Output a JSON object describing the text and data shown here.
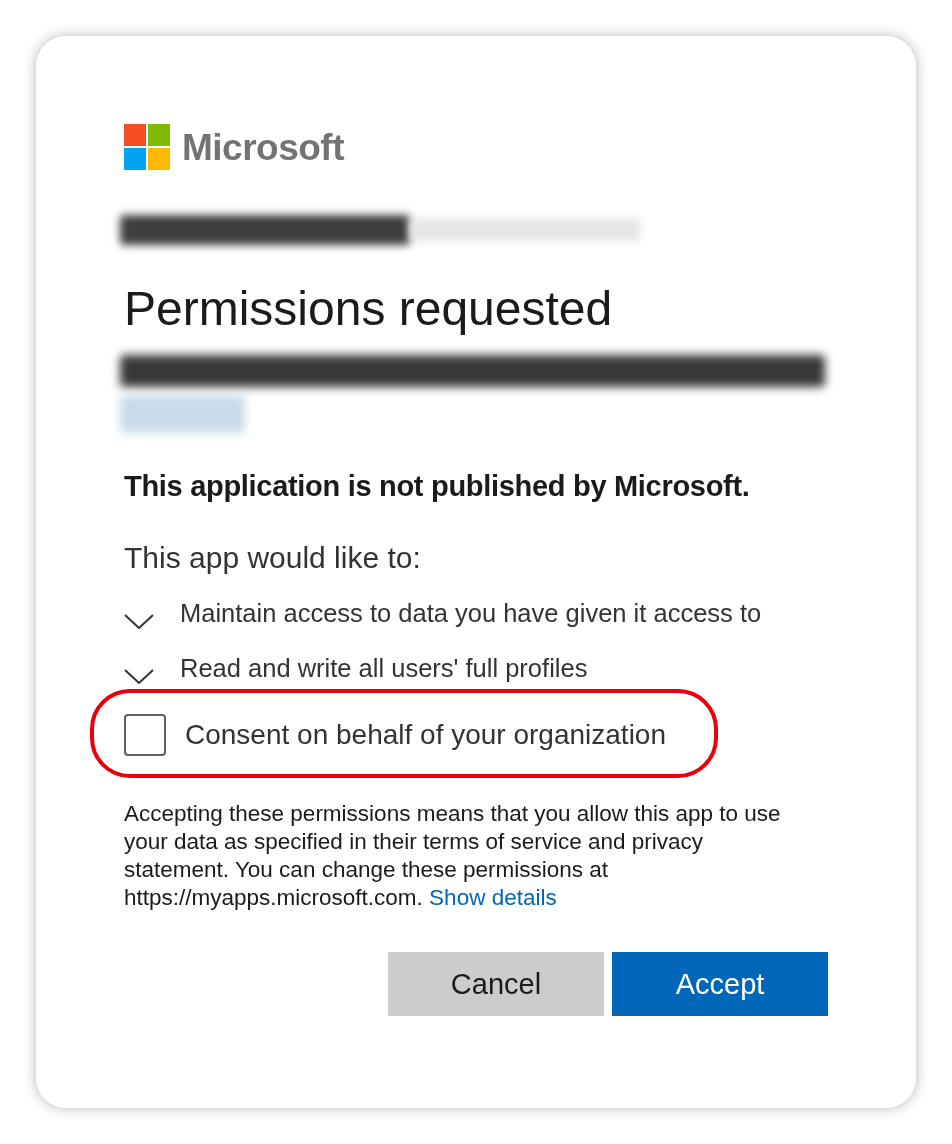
{
  "logo": {
    "wordmark": "Microsoft"
  },
  "title": "Permissions requested",
  "publisher_notice": "This application is not published by Microsoft.",
  "permissions_heading": "This app would like to:",
  "permissions": [
    {
      "label": "Maintain access to data you have given it access to",
      "expanded": false
    },
    {
      "label": "Read and write all users' full profiles",
      "expanded": false
    }
  ],
  "consent": {
    "label": "Consent on behalf of your organization",
    "checked": false,
    "highlighted": true
  },
  "disclaimer": {
    "text": "Accepting these permissions means that you allow this app to use your data as specified in their terms of service and privacy statement. You can change these permissions at https://myapps.microsoft.com.",
    "link": "Show details"
  },
  "buttons": [
    {
      "label": "Cancel",
      "kind": "secondary"
    },
    {
      "label": "Accept",
      "kind": "primary"
    }
  ]
}
